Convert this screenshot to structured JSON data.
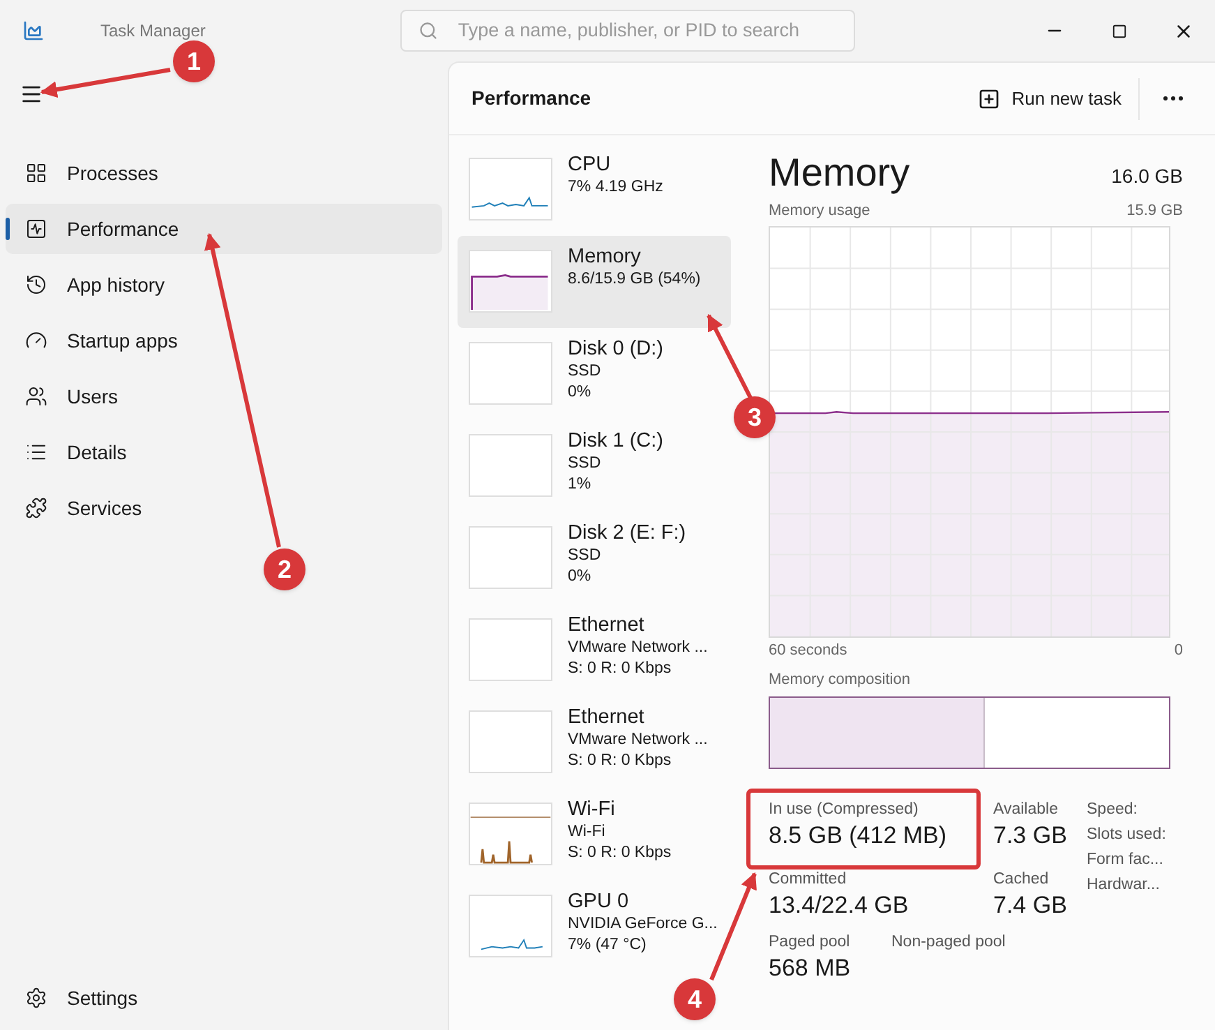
{
  "window": {
    "title": "Task Manager"
  },
  "search": {
    "placeholder": "Type a name, publisher, or PID to search"
  },
  "sidebar": {
    "items": [
      {
        "label": "Processes",
        "kind": "processes",
        "selected": false
      },
      {
        "label": "Performance",
        "kind": "performance",
        "selected": true
      },
      {
        "label": "App history",
        "kind": "history",
        "selected": false
      },
      {
        "label": "Startup apps",
        "kind": "startup",
        "selected": false
      },
      {
        "label": "Users",
        "kind": "users",
        "selected": false
      },
      {
        "label": "Details",
        "kind": "details",
        "selected": false
      },
      {
        "label": "Services",
        "kind": "services",
        "selected": false
      }
    ],
    "settings": "Settings"
  },
  "header": {
    "title": "Performance",
    "run_new_task": "Run new task"
  },
  "devices": [
    {
      "name": "CPU",
      "lines": [
        "7% 4.19 GHz"
      ],
      "kind": "cpu",
      "color": "#1f7fb8",
      "selected": false
    },
    {
      "name": "Memory",
      "lines": [
        "8.6/15.9 GB (54%)"
      ],
      "kind": "memory",
      "color": "#8b2d8b",
      "selected": true
    },
    {
      "name": "Disk 0 (D:)",
      "lines": [
        "SSD",
        "0%"
      ],
      "kind": "empty",
      "selected": false
    },
    {
      "name": "Disk 1 (C:)",
      "lines": [
        "SSD",
        "1%"
      ],
      "kind": "empty",
      "selected": false
    },
    {
      "name": "Disk 2 (E: F:)",
      "lines": [
        "SSD",
        "0%"
      ],
      "kind": "empty",
      "selected": false
    },
    {
      "name": "Ethernet",
      "lines": [
        "VMware Network ...",
        "S: 0 R: 0 Kbps"
      ],
      "kind": "empty",
      "selected": false
    },
    {
      "name": "Ethernet",
      "lines": [
        "VMware Network ...",
        "S: 0 R: 0 Kbps"
      ],
      "kind": "empty",
      "selected": false
    },
    {
      "name": "Wi-Fi",
      "lines": [
        "Wi-Fi",
        "S: 0 R: 0 Kbps"
      ],
      "kind": "wifi",
      "color": "#a0642a",
      "selected": false
    },
    {
      "name": "GPU 0",
      "lines": [
        "NVIDIA GeForce G...",
        "7% (47 °C)"
      ],
      "kind": "gpu",
      "color": "#1f7fb8",
      "selected": false
    }
  ],
  "detail": {
    "title": "Memory",
    "total": "16.0 GB",
    "usage_label": "Memory usage",
    "usage_max": "15.9 GB",
    "time_label": "60 seconds",
    "time_end": "0",
    "composition_label": "Memory composition",
    "composition": {
      "level": 0.54
    },
    "stats_main": [
      {
        "label": "In use (Compressed)",
        "value": "8.5 GB (412 MB)"
      },
      {
        "label": "Available",
        "value": "7.3 GB"
      },
      {
        "label": "Committed",
        "value": "13.4/22.4 GB"
      },
      {
        "label": "Cached",
        "value": "7.4 GB"
      }
    ],
    "stats_side": [
      "Speed:",
      "Slots used:",
      "Form fac...",
      "Hardwar..."
    ],
    "stats_bottom": [
      {
        "label": "Paged pool",
        "value": "568 MB"
      },
      {
        "label": "Non-paged pool"
      }
    ]
  },
  "annotations": [
    "1",
    "2",
    "3",
    "4"
  ]
}
